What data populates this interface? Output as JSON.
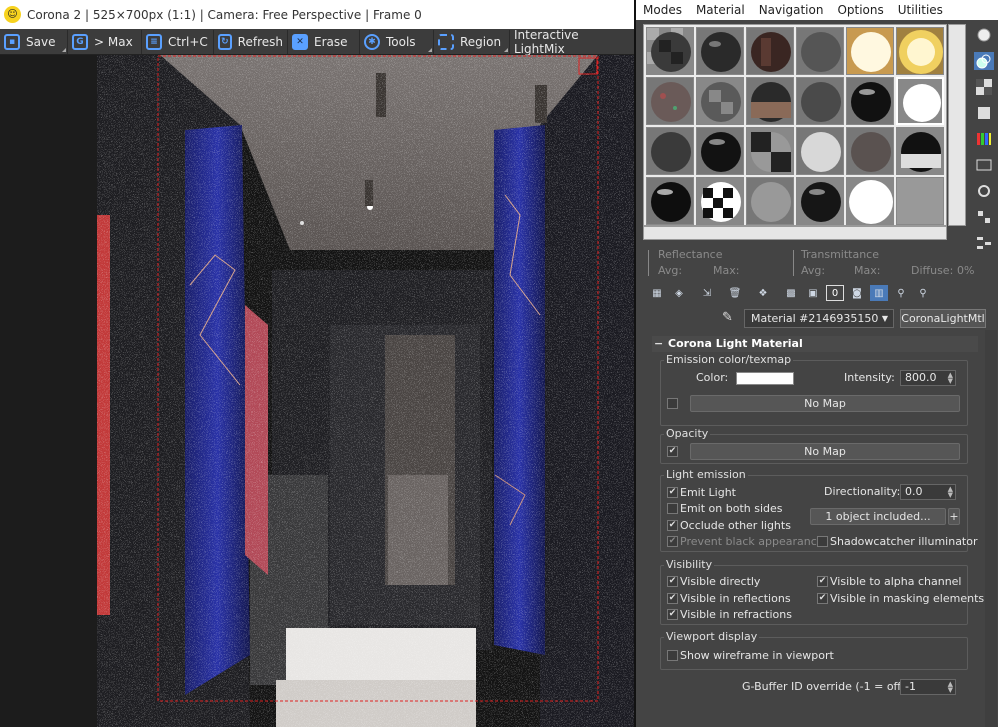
{
  "vfb": {
    "title": "Corona 2 | 525×700px (1:1) | Camera: Free Perspective | Frame 0",
    "toolbar": {
      "save": "Save",
      "max": "> Max",
      "copy": "Ctrl+C",
      "refresh": "Refresh",
      "erase": "Erase",
      "tools": "Tools",
      "region": "Region",
      "lightmix": "Interactive LightMix"
    }
  },
  "menu": [
    "Modes",
    "Material",
    "Navigation",
    "Options",
    "Utilities"
  ],
  "reflectance": {
    "reflectance_label": "Reflectance",
    "transmittance_label": "Transmittance",
    "avg1": "Avg:",
    "max1": "Max:",
    "avg2": "Avg:",
    "max2": "Max:",
    "diffuse": "Diffuse:",
    "diffuse_value": "0%"
  },
  "material": {
    "name": "Material #2146935150",
    "type": "CoronaLightMtl"
  },
  "rollout": {
    "title": "Corona Light Material",
    "emission": {
      "group": "Emission color/texmap",
      "color_label": "Color:",
      "intensity_label": "Intensity:",
      "intensity_value": "800.0",
      "map": "No Map"
    },
    "opacity": {
      "group": "Opacity",
      "map": "No Map"
    },
    "light_emission": {
      "group": "Light emission",
      "emit_light": "Emit Light",
      "emit_both": "Emit on both sides",
      "occlude": "Occlude other lights",
      "prevent_black": "Prevent black appearance",
      "directionality_label": "Directionality:",
      "directionality_value": "0.0",
      "objects_included": "1 object included...",
      "plus": "+",
      "shadowcatcher": "Shadowcatcher illuminator"
    },
    "visibility": {
      "group": "Visibility",
      "visible_directly": "Visible directly",
      "visible_reflections": "Visible in reflections",
      "visible_refractions": "Visible in refractions",
      "visible_alpha": "Visible to alpha channel",
      "visible_masking": "Visible in masking elements"
    },
    "viewport": {
      "group": "Viewport display",
      "wireframe": "Show wireframe in viewport"
    },
    "gbuffer_label": "G-Buffer ID override (-1 = off):",
    "gbuffer_value": "-1"
  }
}
